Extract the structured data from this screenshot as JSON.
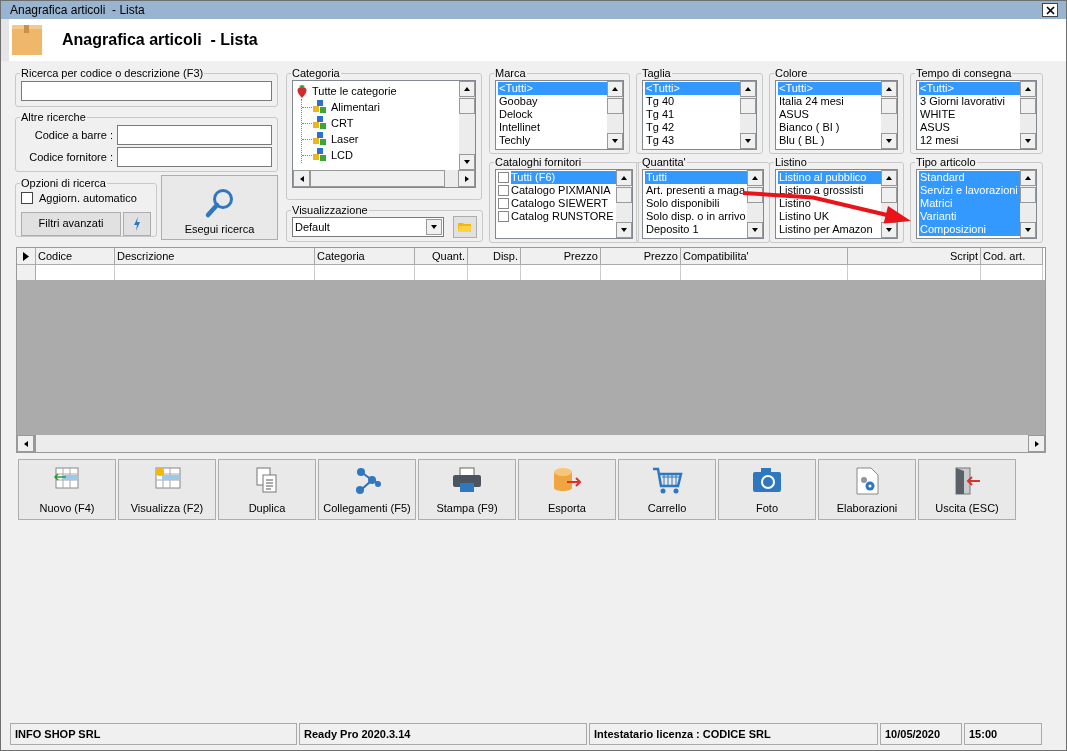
{
  "window": {
    "title": "Anagrafica articoli  - Lista"
  },
  "header": {
    "title": "Anagrafica articoli  - Lista"
  },
  "search": {
    "title": "Ricerca per codice o descrizione (F3)"
  },
  "other_searches": {
    "title": "Altre ricerche",
    "fields": [
      {
        "label": "Codice a barre :"
      },
      {
        "label": "Codice fornitore :"
      }
    ]
  },
  "options": {
    "title": "Opzioni di ricerca",
    "auto_update": {
      "label": "Aggiorn. automatico",
      "checked": false
    },
    "advanced_filters": "Filtri avanzati"
  },
  "search_button": "Esegui ricerca",
  "category": {
    "title": "Categoria",
    "tree": [
      {
        "label": "Tutte le categorie",
        "children": [
          {
            "label": "Alimentari"
          },
          {
            "label": "CRT"
          },
          {
            "label": "Laser"
          },
          {
            "label": "LCD"
          }
        ]
      }
    ]
  },
  "view": {
    "title": "Visualizzazione",
    "value": "Default"
  },
  "lists": [
    {
      "title": "Marca",
      "kind": "list",
      "items": [
        {
          "label": "<Tutti>",
          "selected": true
        },
        {
          "label": "Goobay",
          "selected": false
        },
        {
          "label": "Delock",
          "selected": false
        },
        {
          "label": "Intellinet",
          "selected": false
        },
        {
          "label": "Techly",
          "selected": false
        }
      ]
    },
    {
      "title": "Taglia",
      "kind": "list",
      "items": [
        {
          "label": "<Tutti>",
          "selected": true
        },
        {
          "label": "Tg 40",
          "selected": false
        },
        {
          "label": "Tg 41",
          "selected": false
        },
        {
          "label": "Tg 42",
          "selected": false
        },
        {
          "label": "Tg 43",
          "selected": false
        }
      ]
    },
    {
      "title": "Colore",
      "kind": "list",
      "items": [
        {
          "label": "<Tutti>",
          "selected": true
        },
        {
          "label": "Italia 24 mesi",
          "selected": false
        },
        {
          "label": "ASUS",
          "selected": false
        },
        {
          "label": "Bianco ( BI )",
          "selected": false
        },
        {
          "label": "Blu ( BL )",
          "selected": false
        }
      ]
    },
    {
      "title": "Tempo di consegna",
      "kind": "list",
      "items": [
        {
          "label": "<Tutti>",
          "selected": true
        },
        {
          "label": "3 Giorni lavorativi",
          "selected": false
        },
        {
          "label": "WHITE",
          "selected": false
        },
        {
          "label": "ASUS",
          "selected": false
        },
        {
          "label": "12 mesi",
          "selected": false
        }
      ]
    },
    {
      "title": "Cataloghi fornitori",
      "kind": "checklist",
      "items": [
        {
          "label": "Tutti (F6)",
          "selected": true,
          "checked": false
        },
        {
          "label": "Catalogo PIXMANIA",
          "selected": false,
          "checked": false
        },
        {
          "label": "Catalogo SIEWERT",
          "selected": false,
          "checked": false
        },
        {
          "label": "Catalog RUNSTORE",
          "selected": false,
          "checked": false
        }
      ]
    },
    {
      "title": "Quantita'",
      "kind": "list",
      "items": [
        {
          "label": "Tutti",
          "selected": true
        },
        {
          "label": "Art. presenti a maga",
          "selected": false
        },
        {
          "label": "Solo disponibili",
          "selected": false
        },
        {
          "label": "Solo disp. o in arrivo",
          "selected": false
        },
        {
          "label": "Deposito 1",
          "selected": false
        }
      ]
    },
    {
      "title": "Listino",
      "kind": "list",
      "items": [
        {
          "label": "Listino al pubblico",
          "selected": true
        },
        {
          "label": "Listino a grossisti",
          "selected": false
        },
        {
          "label": "Listino",
          "selected": false
        },
        {
          "label": "Listino UK",
          "selected": false
        },
        {
          "label": "Listino per Amazon",
          "selected": false
        }
      ]
    },
    {
      "title": "Tipo articolo",
      "kind": "list",
      "items": [
        {
          "label": "Standard",
          "selected": true
        },
        {
          "label": "Servizi e lavorazioni",
          "selected": true
        },
        {
          "label": "Matrici",
          "selected": true
        },
        {
          "label": "Varianti",
          "selected": true
        },
        {
          "label": "Composizioni",
          "selected": true
        }
      ]
    }
  ],
  "table": {
    "columns": [
      {
        "label": "Codice"
      },
      {
        "label": "Descrizione"
      },
      {
        "label": "Categoria"
      },
      {
        "label": "Quant."
      },
      {
        "label": "Disp."
      },
      {
        "label": "Prezzo"
      },
      {
        "label": "Prezzo"
      },
      {
        "label": "Compatibilita'"
      },
      {
        "label": "Script"
      },
      {
        "label": "Cod. art."
      }
    ]
  },
  "toolbar": [
    {
      "label": "Nuovo (F4)"
    },
    {
      "label": "Visualizza (F2)"
    },
    {
      "label": "Duplica"
    },
    {
      "label": "Collegamenti (F5)"
    },
    {
      "label": "Stampa (F9)"
    },
    {
      "label": "Esporta"
    },
    {
      "label": "Carrello"
    },
    {
      "label": "Foto"
    },
    {
      "label": "Elaborazioni"
    },
    {
      "label": "Uscita (ESC)"
    }
  ],
  "status_bar": [
    "INFO SHOP SRL",
    "Ready Pro 2020.3.14",
    "Intestatario licenza : CODICE SRL",
    "10/05/2020",
    "15:00"
  ]
}
